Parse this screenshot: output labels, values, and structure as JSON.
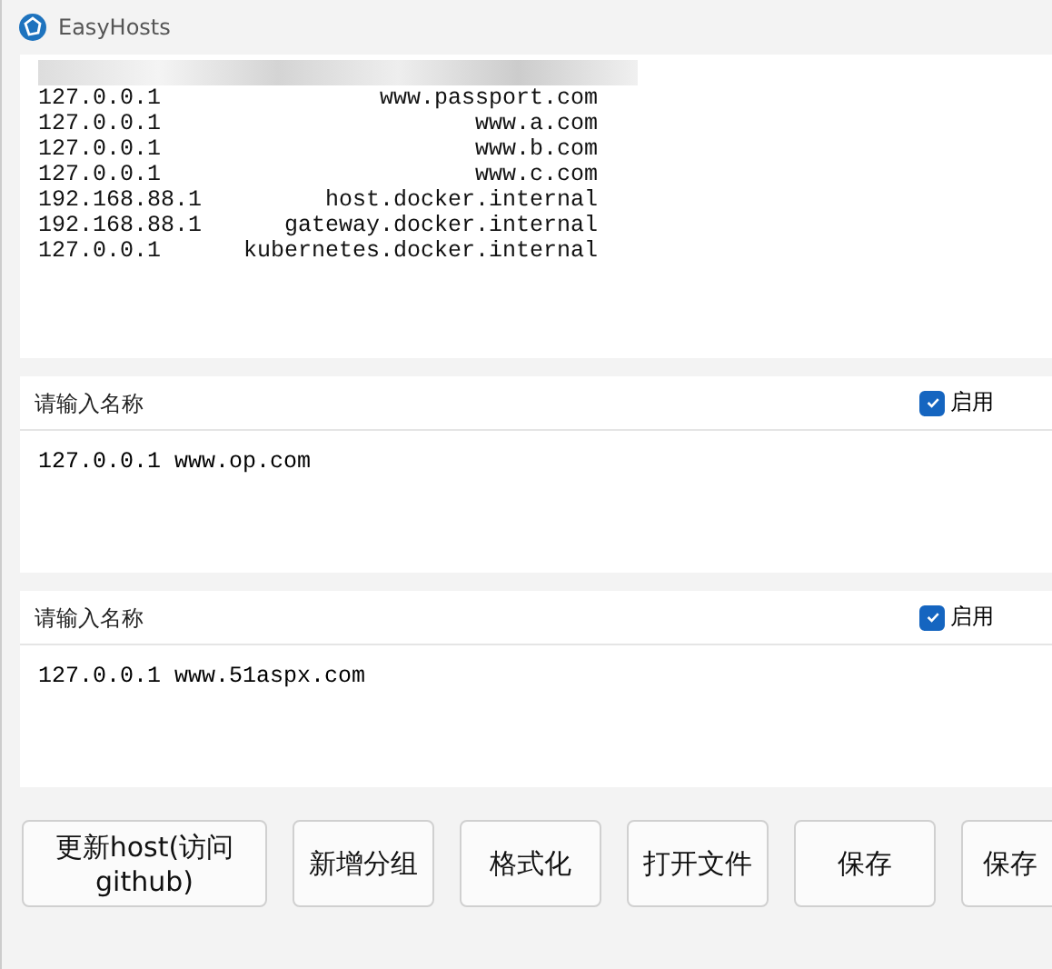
{
  "window": {
    "title": "EasyHosts"
  },
  "hosts": [
    {
      "ip": "127.0.0.1",
      "host": "www.passport.com"
    },
    {
      "ip": "127.0.0.1",
      "host": "www.a.com"
    },
    {
      "ip": "127.0.0.1",
      "host": "www.b.com"
    },
    {
      "ip": "127.0.0.1",
      "host": "www.c.com"
    },
    {
      "ip": "192.168.88.1",
      "host": "host.docker.internal"
    },
    {
      "ip": "192.168.88.1",
      "host": "gateway.docker.internal"
    },
    {
      "ip": "127.0.0.1",
      "host": "kubernetes.docker.internal"
    }
  ],
  "groups": [
    {
      "name_placeholder": "请输入名称",
      "enabled": true,
      "enabled_label": "启用",
      "content": "127.0.0.1 www.op.com"
    },
    {
      "name_placeholder": "请输入名称",
      "enabled": true,
      "enabled_label": "启用",
      "content": "127.0.0.1 www.51aspx.com"
    }
  ],
  "buttons": [
    "更新host(访问github)",
    "新增分组",
    "格式化",
    "打开文件",
    "保存",
    "保存"
  ]
}
